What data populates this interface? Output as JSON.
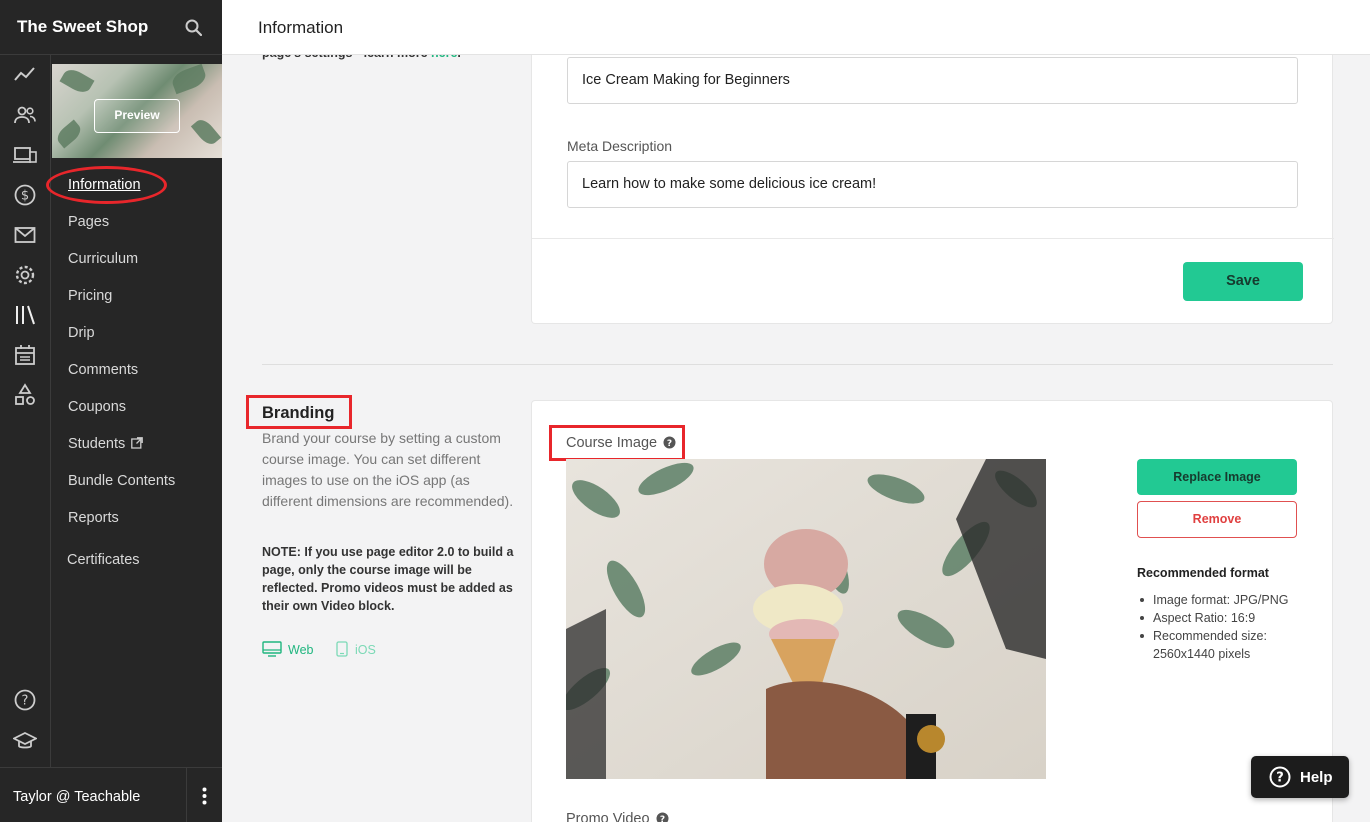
{
  "app": {
    "school_name": "The Sweet Shop",
    "user_label": "Taylor @ Teachable"
  },
  "header": {
    "title": "Information"
  },
  "sidebar": {
    "preview_label": "Preview",
    "items": [
      {
        "label": "Information",
        "active": true
      },
      {
        "label": "Pages"
      },
      {
        "label": "Curriculum"
      },
      {
        "label": "Pricing"
      },
      {
        "label": "Drip"
      },
      {
        "label": "Comments"
      },
      {
        "label": "Coupons"
      },
      {
        "label": "Students",
        "icon": "external-link-icon"
      },
      {
        "label": "Bundle Contents"
      },
      {
        "label": "Reports"
      },
      {
        "label": "Certificates"
      }
    ],
    "rail_icons": [
      "analytics-icon",
      "users-icon",
      "sites-icon",
      "sales-icon",
      "email-icon",
      "settings-icon",
      "courses-library-icon",
      "calendar-icon",
      "shapes-icon",
      "help-circle-icon",
      "graduation-cap-icon"
    ]
  },
  "seo": {
    "cut_text_prefix": "page's settings - learn more ",
    "cut_link": "here",
    "cut_text_suffix": ".",
    "title_value": "Ice Cream Making for Beginners",
    "meta_description_label": "Meta Description",
    "meta_description_value": "Learn how to make some delicious ice cream!",
    "save_label": "Save"
  },
  "branding": {
    "title": "Branding",
    "description": "Brand your course by setting a custom course image. You can set different images to use on the iOS app (as different dimensions are recommended).",
    "note": "NOTE: If you use page editor 2.0 to build a page, only the course image will be reflected. Promo videos must be added as their own Video block.",
    "tabs": [
      {
        "label": "Web",
        "active": true
      },
      {
        "label": "iOS",
        "active": false
      }
    ],
    "course_image_label": "Course Image",
    "replace_label": "Replace Image",
    "remove_label": "Remove",
    "recommended_title": "Recommended format",
    "recommended_items": [
      "Image format: JPG/PNG",
      "Aspect Ratio: 16:9",
      "Recommended size: 2560x1440 pixels"
    ],
    "promo_video_label": "Promo Video"
  },
  "help": {
    "label": "Help"
  },
  "colors": {
    "accent": "#22c993",
    "annotation_red": "#e8262b",
    "sidebar_bg": "#262626"
  }
}
